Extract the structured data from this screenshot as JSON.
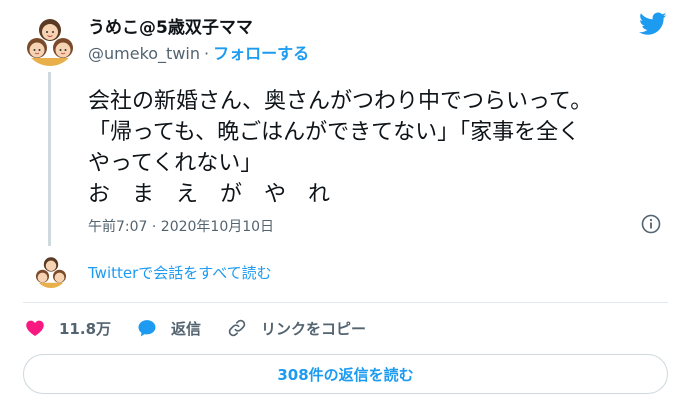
{
  "author": {
    "name": "うめこ@5歳双子ママ",
    "handle": "@umeko_twin",
    "separator": "·",
    "follow_label": "フォローする"
  },
  "tweet": {
    "lines": [
      "会社の新婚さん、奥さんがつわり中でつらいって。",
      "「帰っても、晩ごはんができてない」「家事を全く",
      "やってくれない」",
      "お　ま　え　が　や　れ"
    ],
    "timestamp": "午前7:07 · 2020年10月10日"
  },
  "conversation": {
    "read_all_label": "Twitterで会話をすべて読む"
  },
  "actions": {
    "like_count": "11.8万",
    "reply_label": "返信",
    "copy_link_label": "リンクをコピー"
  },
  "replies_button": {
    "label": "308件の返信を読む"
  },
  "icons": {
    "bird": "twitter-bird-icon",
    "info": "info-icon",
    "like": "heart-icon",
    "reply": "speech-bubble-icon",
    "link": "link-icon"
  },
  "colors": {
    "accent": "#1d9bf0",
    "like": "#f91880",
    "muted": "#536471",
    "text": "#0f1419"
  }
}
